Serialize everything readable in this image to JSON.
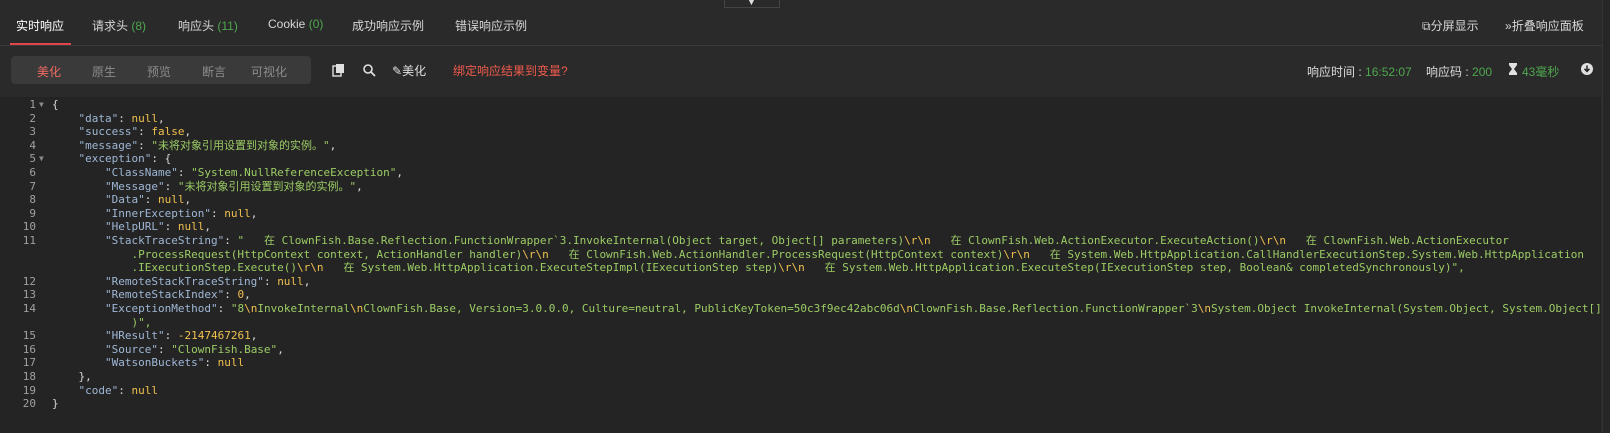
{
  "tabs": [
    {
      "label": "实时响应",
      "count": ""
    },
    {
      "label": "请求头",
      "count": "(8)"
    },
    {
      "label": "响应头",
      "count": "(11)"
    },
    {
      "label": "Cookie",
      "count": "(0)"
    },
    {
      "label": "成功响应示例",
      "count": ""
    },
    {
      "label": "错误响应示例",
      "count": ""
    }
  ],
  "header_actions": {
    "split": "分屏显示",
    "collapse": "折叠响应面板"
  },
  "view_modes": [
    "美化",
    "原生",
    "预览",
    "断言",
    "可视化"
  ],
  "active_view_mode": "美化",
  "toolbar": {
    "beautify": "美化",
    "bind_link": "绑定响应结果到变量?"
  },
  "meta": {
    "time_label": "响应时间 : ",
    "time_value": "16:52:07",
    "code_label": "响应码 : ",
    "code_value": "200",
    "duration": "43毫秒"
  },
  "colors": {
    "accent": "#e0454b",
    "success": "#4ea74e",
    "string": "#9ccc65",
    "keyword": "#f0c04f"
  },
  "code_lines": [
    "{",
    "    \"data\": null,",
    "    \"success\": false,",
    "    \"message\": \"未将对象引用设置到对象的实例。\",",
    "    \"exception\": {",
    "        \"ClassName\": \"System.NullReferenceException\",",
    "        \"Message\": \"未将对象引用设置到对象的实例。\",",
    "        \"Data\": null,",
    "        \"InnerException\": null,",
    "        \"HelpURL\": null,",
    "        \"StackTraceString\": \"   在 ClownFish.Base.Reflection.FunctionWrapper`3.InvokeInternal(Object target, Object[] parameters)\\r\\n   在 ClownFish.Web.ActionExecutor.ExecuteAction()\\r\\n   在 ClownFish.Web.ActionExecutor",
    "            .ProcessRequest(HttpContext context, ActionHandler handler)\\r\\n   在 ClownFish.Web.ActionHandler.ProcessRequest(HttpContext context)\\r\\n   在 System.Web.HttpApplication.CallHandlerExecutionStep.System.Web.HttpApplication",
    "            .IExecutionStep.Execute()\\r\\n   在 System.Web.HttpApplication.ExecuteStepImpl(IExecutionStep step)\\r\\n   在 System.Web.HttpApplication.ExecuteStep(IExecutionStep step, Boolean& completedSynchronously)\",",
    "        \"RemoteStackTraceString\": null,",
    "        \"RemoteStackIndex\": 0,",
    "        \"ExceptionMethod\": \"8\\nInvokeInternal\\nClownFish.Base, Version=3.0.0.0, Culture=neutral, PublicKeyToken=50c3f9ec42abc06d\\nClownFish.Base.Reflection.FunctionWrapper`3\\nSystem.Object InvokeInternal(System.Object, System.Object[]",
    "            )\",",
    "        \"HResult\": -2147467261,",
    "        \"Source\": \"ClownFish.Base\",",
    "        \"WatsonBuckets\": null",
    "    },",
    "    \"code\": null",
    "}"
  ],
  "line_numbers": [
    "1",
    "2",
    "3",
    "4",
    "5",
    "6",
    "7",
    "8",
    "9",
    "10",
    "11",
    "",
    "",
    "12",
    "13",
    "14",
    "",
    "15",
    "16",
    "17",
    "18",
    "19",
    "20"
  ]
}
